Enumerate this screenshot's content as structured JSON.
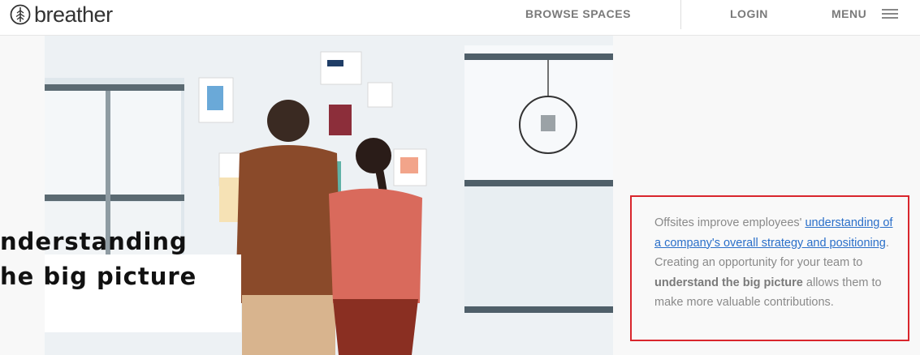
{
  "header": {
    "brand": "breather",
    "nav": {
      "browse": "BROWSE SPACES",
      "login": "LOGIN",
      "menu": "MENU"
    }
  },
  "hero": {
    "title_line1": "nderstanding",
    "title_line2": "he big picture",
    "image_icon": "office-people-photo"
  },
  "callout": {
    "text_1": "Offsites improve employees'",
    "link": "understanding of a company's overall strategy and positioning",
    "text_2": ". Creating an opportunity for your team to",
    "bold": "understand the big picture",
    "text_3": "allows them to make more valuable contributions."
  },
  "colors": {
    "accent_border": "#d9262d",
    "link": "#2a6fc9"
  }
}
